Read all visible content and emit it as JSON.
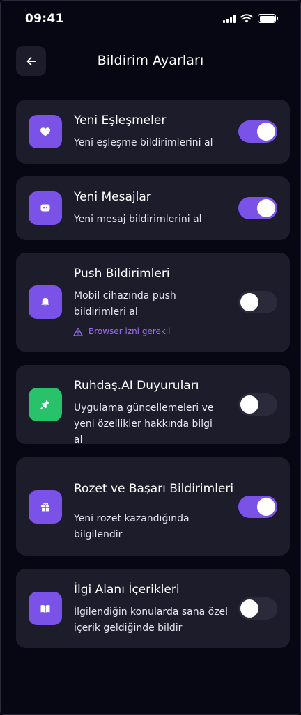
{
  "status_bar": {
    "time": "09:41"
  },
  "header": {
    "title": "Bildirim Ayarları"
  },
  "colors": {
    "accent": "#7b52e8",
    "green": "#27c26a",
    "card": "#1c1c2b",
    "background": "#070713"
  },
  "settings": [
    {
      "title": "Yeni Eşleşmeler",
      "description": "Yeni eşleşme bildirimlerini al",
      "icon": "heart-icon",
      "enabled": true
    },
    {
      "title": "Yeni Mesajlar",
      "description": "Yeni mesaj bildirimlerini al",
      "icon": "chat-bubble-icon",
      "enabled": true
    },
    {
      "title": "Push Bildirimleri",
      "description": "Mobil cihazında push bildirimleri al",
      "icon": "bell-icon",
      "enabled": false,
      "warning": "Browser izni gerekli"
    },
    {
      "title": "Ruhdaş.AI Duyuruları",
      "description": "Uygulama güncellemeleri ve yeni özellikler hakkında bilgi al",
      "icon": "pin-icon",
      "enabled": false
    },
    {
      "title": "Rozet ve Başarı Bildirimleri",
      "description": "Yeni rozet kazandığında bilgilendir",
      "icon": "gift-icon",
      "enabled": true
    },
    {
      "title": "İlgi Alanı İçerikleri",
      "description": "İlgilendiğin konularda sana özel içerik geldiğinde bildir",
      "icon": "book-icon",
      "enabled": false
    }
  ]
}
